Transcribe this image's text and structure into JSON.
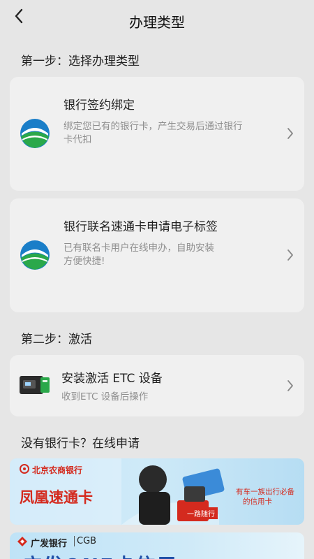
{
  "header": {
    "title": "办理类型"
  },
  "step1": {
    "label": "第一步：选择办理类型",
    "cards": [
      {
        "title": "银行签约绑定",
        "desc_line1": "绑定您已有的银行卡，产生交易后通过银行",
        "desc_line2": "卡代扣"
      },
      {
        "title": "银行联名速通卡申请电子标签",
        "desc_line1": "已有联名卡用户在线申办，自助安装",
        "desc_line2": "方便快捷!"
      }
    ]
  },
  "step2": {
    "label": "第二步：激活",
    "card": {
      "title": "安装激活 ETC 设备",
      "desc": "收到ETC 设备后操作"
    }
  },
  "apply": {
    "label": "没有银行卡？在线申请",
    "banner1": {
      "bank_name": "北京农商银行",
      "card_name": "凤凰速通卡",
      "slogan_line1": "有车一族出行必备",
      "slogan_line2": "的信用卡",
      "tag": "一路随行"
    },
    "banner2": {
      "bank_name": "广发银行",
      "bank_code": "CGB",
      "big_text": "广发ONE卡信用"
    }
  },
  "colors": {
    "accent_blue": "#1a7ec8",
    "accent_green": "#2aa84a",
    "banner_red": "#d42a1e"
  }
}
